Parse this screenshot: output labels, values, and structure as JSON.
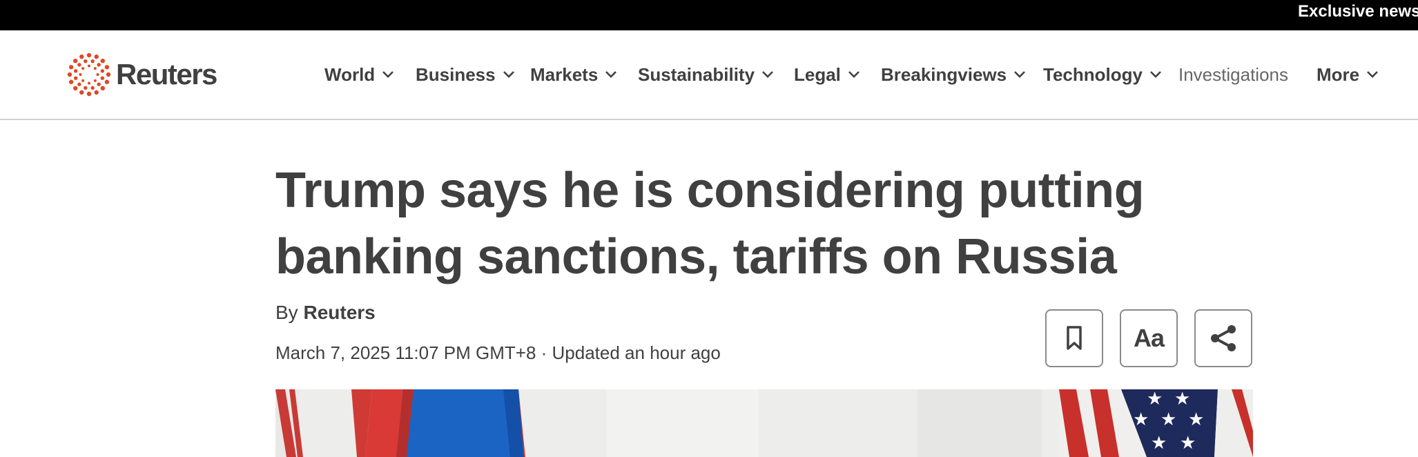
{
  "banner": {
    "text": "Exclusive news"
  },
  "logo": {
    "name": "Reuters",
    "color": "#dc4a24"
  },
  "nav": {
    "items": [
      {
        "label": "World",
        "has_dropdown": true
      },
      {
        "label": "Business",
        "has_dropdown": true
      },
      {
        "label": "Markets",
        "has_dropdown": true
      },
      {
        "label": "Sustainability",
        "has_dropdown": true
      },
      {
        "label": "Legal",
        "has_dropdown": true
      },
      {
        "label": "Breakingviews",
        "has_dropdown": true
      },
      {
        "label": "Technology",
        "has_dropdown": true
      },
      {
        "label": "Investigations",
        "has_dropdown": false
      },
      {
        "label": "More",
        "has_dropdown": true
      }
    ]
  },
  "article": {
    "headline": "Trump says he is considering putting banking sanctions, tariffs on Russia",
    "byline_prefix": "By",
    "author": "Reuters",
    "dateline": "March 7, 2025 11:07 PM GMT+8 · Updated an hour ago"
  },
  "tools": {
    "bookmark_icon": "bookmark-icon",
    "text_size_label": "Aa",
    "share_icon": "share-icon"
  },
  "hero": {
    "icons": [
      "russian-flag",
      "us-flag"
    ]
  }
}
